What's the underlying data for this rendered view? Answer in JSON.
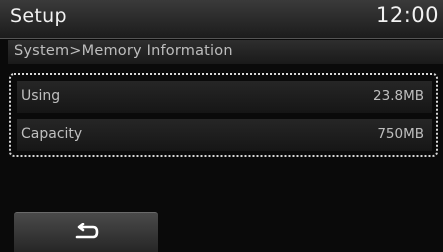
{
  "header": {
    "title": "Setup",
    "clock": "12:00"
  },
  "breadcrumb": {
    "text": "System>Memory Information"
  },
  "memory_info": {
    "rows": [
      {
        "label": "Using",
        "value": "23.8MB"
      },
      {
        "label": "Capacity",
        "value": "750MB"
      }
    ]
  },
  "footer": {
    "back_button_icon": "back-arrow-icon"
  }
}
